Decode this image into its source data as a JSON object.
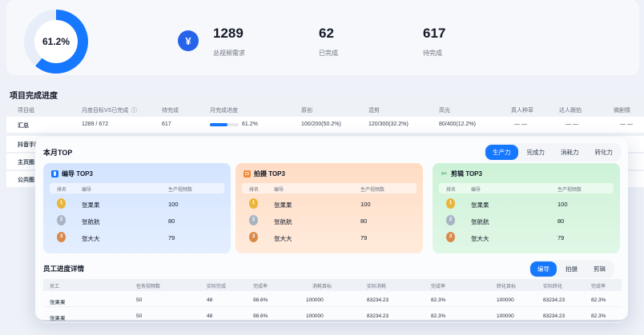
{
  "summary": {
    "completion_percent": 61.2,
    "completion_label": "61.2%",
    "stats": [
      {
        "value": "1289",
        "label": "总视频需求"
      },
      {
        "value": "62",
        "label": "已完成"
      },
      {
        "value": "617",
        "label": "待完成"
      }
    ]
  },
  "project": {
    "title": "项目完成进度",
    "headers": [
      "项目组",
      "月度目标VS已完成",
      "待完成",
      "月完成进度",
      "原创",
      "混剪",
      "高光",
      "真人种草",
      "达人跟拍",
      "微剧情"
    ],
    "rows": [
      {
        "group": "汇总",
        "target": "1289  /  672",
        "pending": "617",
        "progress": 61.2,
        "progress_label": "61.2%",
        "original": "100/200(50.2%)",
        "mix": "120/300(32.2%)",
        "highlight": "80/400(12.2%)",
        "real": "— —",
        "influencer": "— —",
        "drama": "— —"
      },
      {
        "group": "抖音手阵"
      },
      {
        "group": "主页图"
      },
      {
        "group": "公共图"
      }
    ]
  },
  "monthly_top": {
    "title": "本月TOP",
    "tabs": [
      "生产力",
      "完成力",
      "消耗力",
      "转化力"
    ],
    "active_tab": 0,
    "cards": [
      {
        "title": "编导 TOP3",
        "headers": [
          "排名",
          "编导",
          "生产视频数"
        ],
        "rows": [
          {
            "rank": "1",
            "name": "张果果",
            "value": "100"
          },
          {
            "rank": "2",
            "name": "张航航",
            "value": "80"
          },
          {
            "rank": "3",
            "name": "张大大",
            "value": "79"
          }
        ]
      },
      {
        "title": "拍摄 TOP3",
        "headers": [
          "排名",
          "编导",
          "生产视频数"
        ],
        "rows": [
          {
            "rank": "1",
            "name": "张果果",
            "value": "100"
          },
          {
            "rank": "2",
            "name": "张航航",
            "value": "80"
          },
          {
            "rank": "3",
            "name": "张大大",
            "value": "79"
          }
        ]
      },
      {
        "title": "剪辑 TOP3",
        "headers": [
          "排名",
          "编导",
          "生产视频数"
        ],
        "rows": [
          {
            "rank": "1",
            "name": "张果果",
            "value": "100"
          },
          {
            "rank": "2",
            "name": "张航航",
            "value": "80"
          },
          {
            "rank": "3",
            "name": "张大大",
            "value": "79"
          }
        ]
      }
    ]
  },
  "employee": {
    "title": "员工进度详情",
    "tabs": [
      "编导",
      "拍摄",
      "剪辑"
    ],
    "active_tab": 0,
    "headers": [
      "员工",
      "任务视频数",
      "实际完成",
      "完成率",
      "消耗目标",
      "实际消耗",
      "完成率",
      "转化目标",
      "实际转化",
      "完成率"
    ],
    "rows": [
      [
        "张果果",
        "50",
        "48",
        "98.6%",
        "100000",
        "83234.23",
        "82.3%",
        "100000",
        "83234.23",
        "82.3%"
      ],
      [
        "张果果",
        "50",
        "48",
        "98.6%",
        "100000",
        "83234.23",
        "82.3%",
        "100000",
        "83234.23",
        "82.3%"
      ]
    ]
  },
  "colors": {
    "accent": "#1677ff",
    "card_blue": "#dbe9ff",
    "card_orange": "#ffe6d2",
    "card_green": "#d8f5df"
  }
}
